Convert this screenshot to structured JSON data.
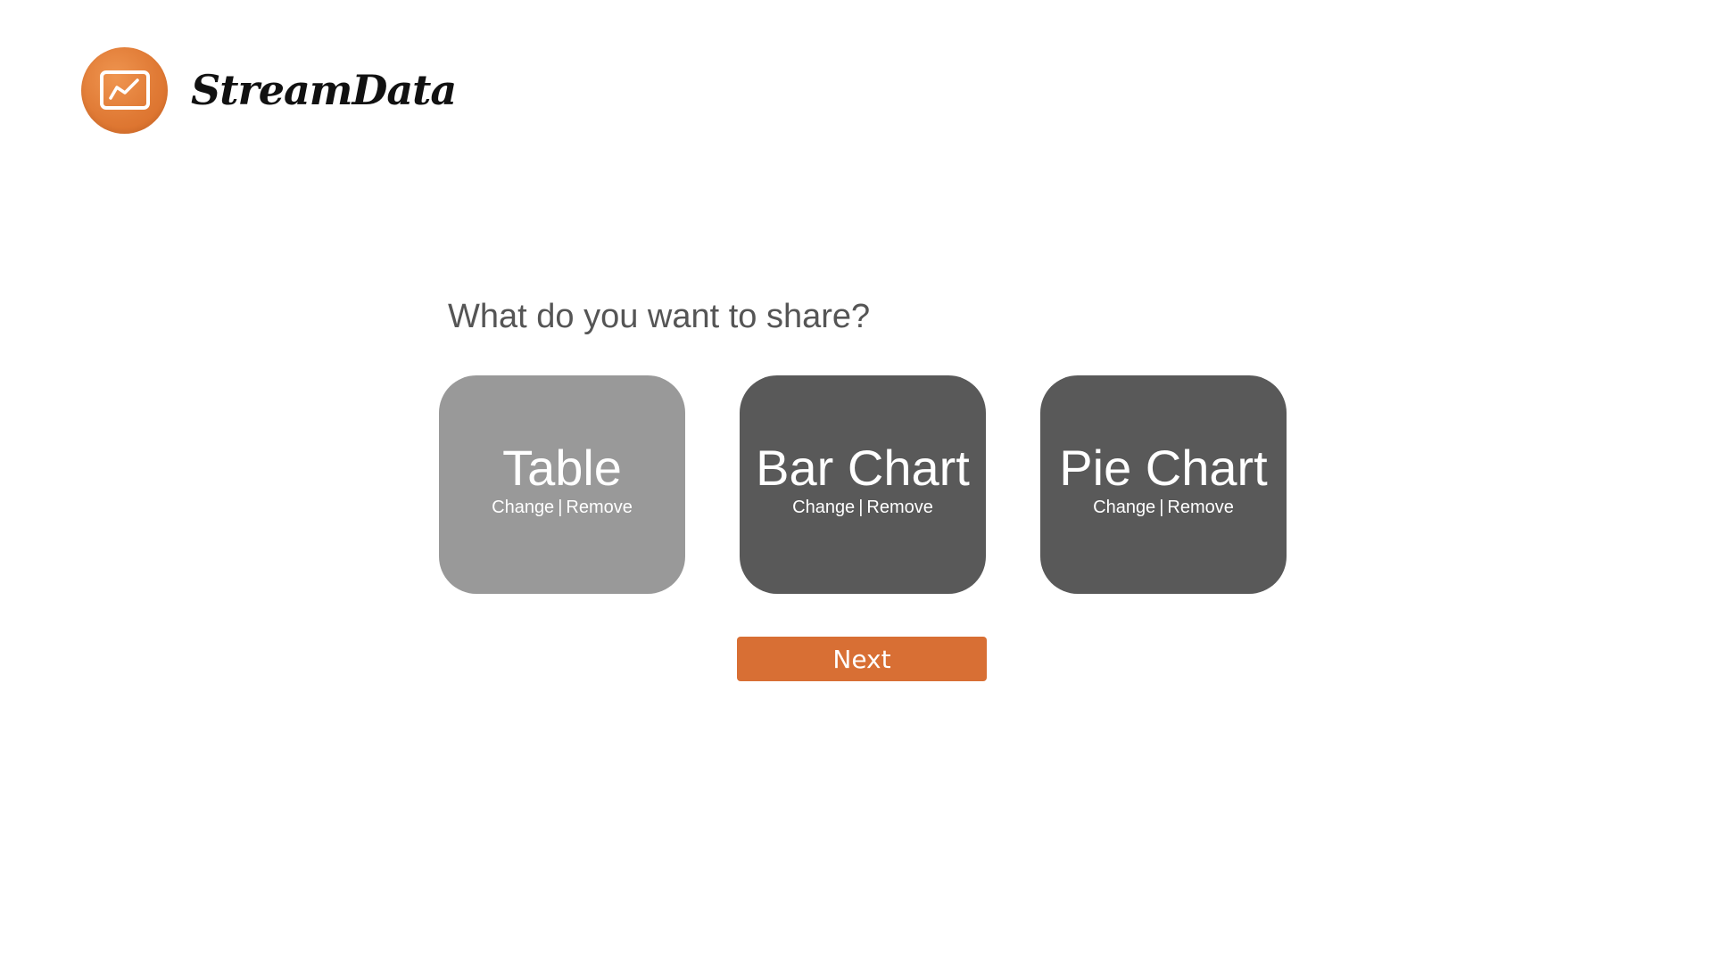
{
  "brand": {
    "name": "StreamData",
    "logo_icon": "line-chart-monitor-icon",
    "logo_color": "#e07a35"
  },
  "prompt": "What do you want to share?",
  "options": [
    {
      "title": "Table",
      "change_label": "Change",
      "separator": "|",
      "remove_label": "Remove",
      "selected": true
    },
    {
      "title": "Bar Chart",
      "change_label": "Change",
      "separator": "|",
      "remove_label": "Remove",
      "selected": false
    },
    {
      "title": "Pie Chart",
      "change_label": "Change",
      "separator": "|",
      "remove_label": "Remove",
      "selected": false
    }
  ],
  "next_button": {
    "label": "Next",
    "color": "#d86f34"
  },
  "colors": {
    "card_default": "#595959",
    "card_selected": "#999999",
    "prompt_text": "#555555"
  }
}
